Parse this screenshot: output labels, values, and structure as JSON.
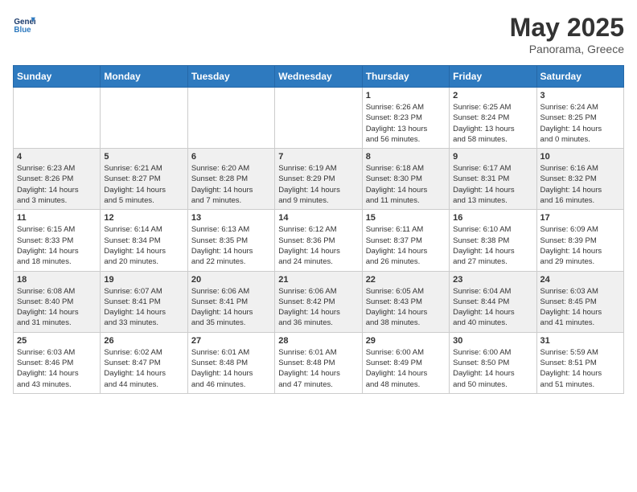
{
  "logo": {
    "line1": "General",
    "line2": "Blue"
  },
  "title": {
    "month_year": "May 2025",
    "location": "Panorama, Greece"
  },
  "days_of_week": [
    "Sunday",
    "Monday",
    "Tuesday",
    "Wednesday",
    "Thursday",
    "Friday",
    "Saturday"
  ],
  "weeks": [
    [
      {
        "day": "",
        "info": ""
      },
      {
        "day": "",
        "info": ""
      },
      {
        "day": "",
        "info": ""
      },
      {
        "day": "",
        "info": ""
      },
      {
        "day": "1",
        "info": "Sunrise: 6:26 AM\nSunset: 8:23 PM\nDaylight: 13 hours\nand 56 minutes."
      },
      {
        "day": "2",
        "info": "Sunrise: 6:25 AM\nSunset: 8:24 PM\nDaylight: 13 hours\nand 58 minutes."
      },
      {
        "day": "3",
        "info": "Sunrise: 6:24 AM\nSunset: 8:25 PM\nDaylight: 14 hours\nand 0 minutes."
      }
    ],
    [
      {
        "day": "4",
        "info": "Sunrise: 6:23 AM\nSunset: 8:26 PM\nDaylight: 14 hours\nand 3 minutes."
      },
      {
        "day": "5",
        "info": "Sunrise: 6:21 AM\nSunset: 8:27 PM\nDaylight: 14 hours\nand 5 minutes."
      },
      {
        "day": "6",
        "info": "Sunrise: 6:20 AM\nSunset: 8:28 PM\nDaylight: 14 hours\nand 7 minutes."
      },
      {
        "day": "7",
        "info": "Sunrise: 6:19 AM\nSunset: 8:29 PM\nDaylight: 14 hours\nand 9 minutes."
      },
      {
        "day": "8",
        "info": "Sunrise: 6:18 AM\nSunset: 8:30 PM\nDaylight: 14 hours\nand 11 minutes."
      },
      {
        "day": "9",
        "info": "Sunrise: 6:17 AM\nSunset: 8:31 PM\nDaylight: 14 hours\nand 13 minutes."
      },
      {
        "day": "10",
        "info": "Sunrise: 6:16 AM\nSunset: 8:32 PM\nDaylight: 14 hours\nand 16 minutes."
      }
    ],
    [
      {
        "day": "11",
        "info": "Sunrise: 6:15 AM\nSunset: 8:33 PM\nDaylight: 14 hours\nand 18 minutes."
      },
      {
        "day": "12",
        "info": "Sunrise: 6:14 AM\nSunset: 8:34 PM\nDaylight: 14 hours\nand 20 minutes."
      },
      {
        "day": "13",
        "info": "Sunrise: 6:13 AM\nSunset: 8:35 PM\nDaylight: 14 hours\nand 22 minutes."
      },
      {
        "day": "14",
        "info": "Sunrise: 6:12 AM\nSunset: 8:36 PM\nDaylight: 14 hours\nand 24 minutes."
      },
      {
        "day": "15",
        "info": "Sunrise: 6:11 AM\nSunset: 8:37 PM\nDaylight: 14 hours\nand 26 minutes."
      },
      {
        "day": "16",
        "info": "Sunrise: 6:10 AM\nSunset: 8:38 PM\nDaylight: 14 hours\nand 27 minutes."
      },
      {
        "day": "17",
        "info": "Sunrise: 6:09 AM\nSunset: 8:39 PM\nDaylight: 14 hours\nand 29 minutes."
      }
    ],
    [
      {
        "day": "18",
        "info": "Sunrise: 6:08 AM\nSunset: 8:40 PM\nDaylight: 14 hours\nand 31 minutes."
      },
      {
        "day": "19",
        "info": "Sunrise: 6:07 AM\nSunset: 8:41 PM\nDaylight: 14 hours\nand 33 minutes."
      },
      {
        "day": "20",
        "info": "Sunrise: 6:06 AM\nSunset: 8:41 PM\nDaylight: 14 hours\nand 35 minutes."
      },
      {
        "day": "21",
        "info": "Sunrise: 6:06 AM\nSunset: 8:42 PM\nDaylight: 14 hours\nand 36 minutes."
      },
      {
        "day": "22",
        "info": "Sunrise: 6:05 AM\nSunset: 8:43 PM\nDaylight: 14 hours\nand 38 minutes."
      },
      {
        "day": "23",
        "info": "Sunrise: 6:04 AM\nSunset: 8:44 PM\nDaylight: 14 hours\nand 40 minutes."
      },
      {
        "day": "24",
        "info": "Sunrise: 6:03 AM\nSunset: 8:45 PM\nDaylight: 14 hours\nand 41 minutes."
      }
    ],
    [
      {
        "day": "25",
        "info": "Sunrise: 6:03 AM\nSunset: 8:46 PM\nDaylight: 14 hours\nand 43 minutes."
      },
      {
        "day": "26",
        "info": "Sunrise: 6:02 AM\nSunset: 8:47 PM\nDaylight: 14 hours\nand 44 minutes."
      },
      {
        "day": "27",
        "info": "Sunrise: 6:01 AM\nSunset: 8:48 PM\nDaylight: 14 hours\nand 46 minutes."
      },
      {
        "day": "28",
        "info": "Sunrise: 6:01 AM\nSunset: 8:48 PM\nDaylight: 14 hours\nand 47 minutes."
      },
      {
        "day": "29",
        "info": "Sunrise: 6:00 AM\nSunset: 8:49 PM\nDaylight: 14 hours\nand 48 minutes."
      },
      {
        "day": "30",
        "info": "Sunrise: 6:00 AM\nSunset: 8:50 PM\nDaylight: 14 hours\nand 50 minutes."
      },
      {
        "day": "31",
        "info": "Sunrise: 5:59 AM\nSunset: 8:51 PM\nDaylight: 14 hours\nand 51 minutes."
      }
    ]
  ]
}
